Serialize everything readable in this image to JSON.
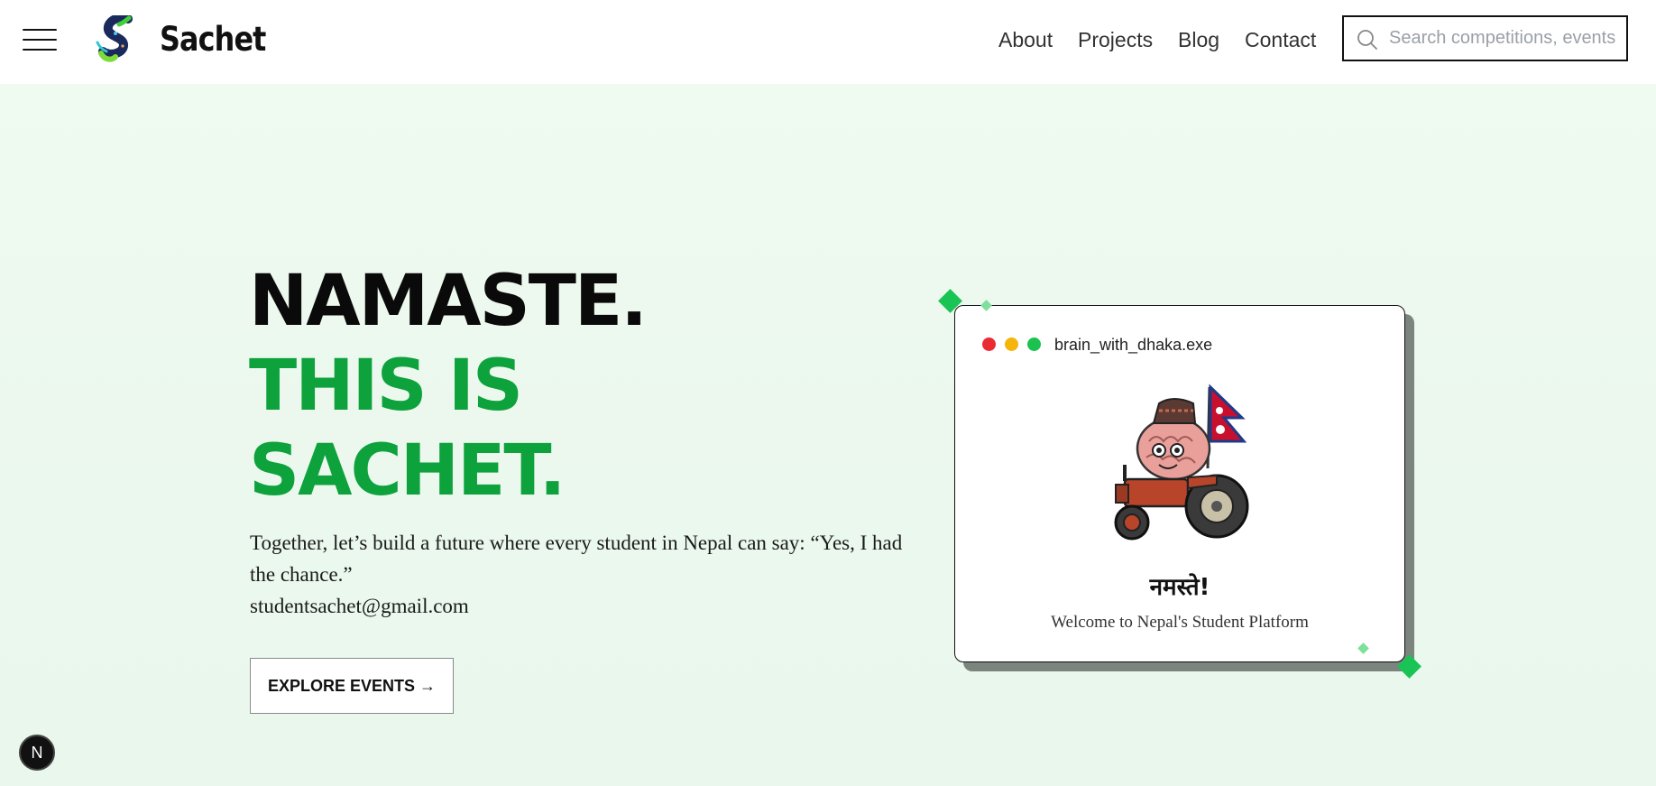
{
  "header": {
    "brand": "Sachet",
    "nav": {
      "about": "About",
      "projects": "Projects",
      "blog": "Blog",
      "contact": "Contact"
    },
    "search": {
      "placeholder": "Search competitions, events",
      "value": ""
    },
    "icons": [
      "hamburger-menu-icon",
      "sachet-logo-icon",
      "search-icon"
    ]
  },
  "hero": {
    "headline_line1": "NAMASTE.",
    "headline_line2": "THIS IS",
    "headline_line3": "SACHET.",
    "tagline": "Together, let’s build a future where every student in Nepal can say: “Yes, I had the chance.”",
    "email": "studentsachet@gmail.com",
    "cta_label": "EXPLORE EVENTS →"
  },
  "window_card": {
    "title": "brain_with_dhaka.exe",
    "greeting": "नमस्ते!",
    "subtitle": "Welcome to Nepal's Student Platform",
    "mascot_icon": "brain-driving-tractor-with-nepal-flag"
  },
  "badge": {
    "label": "N"
  },
  "colors": {
    "accent_green": "#0da23c",
    "diamond_green": "#19c454",
    "diamond_light": "#7fe09c",
    "hero_bg": "#edf9ef",
    "card_shadow": "#7b857d",
    "dot_red": "#ea2b33",
    "dot_yellow": "#f5b50b",
    "dot_green": "#1cc24f"
  }
}
